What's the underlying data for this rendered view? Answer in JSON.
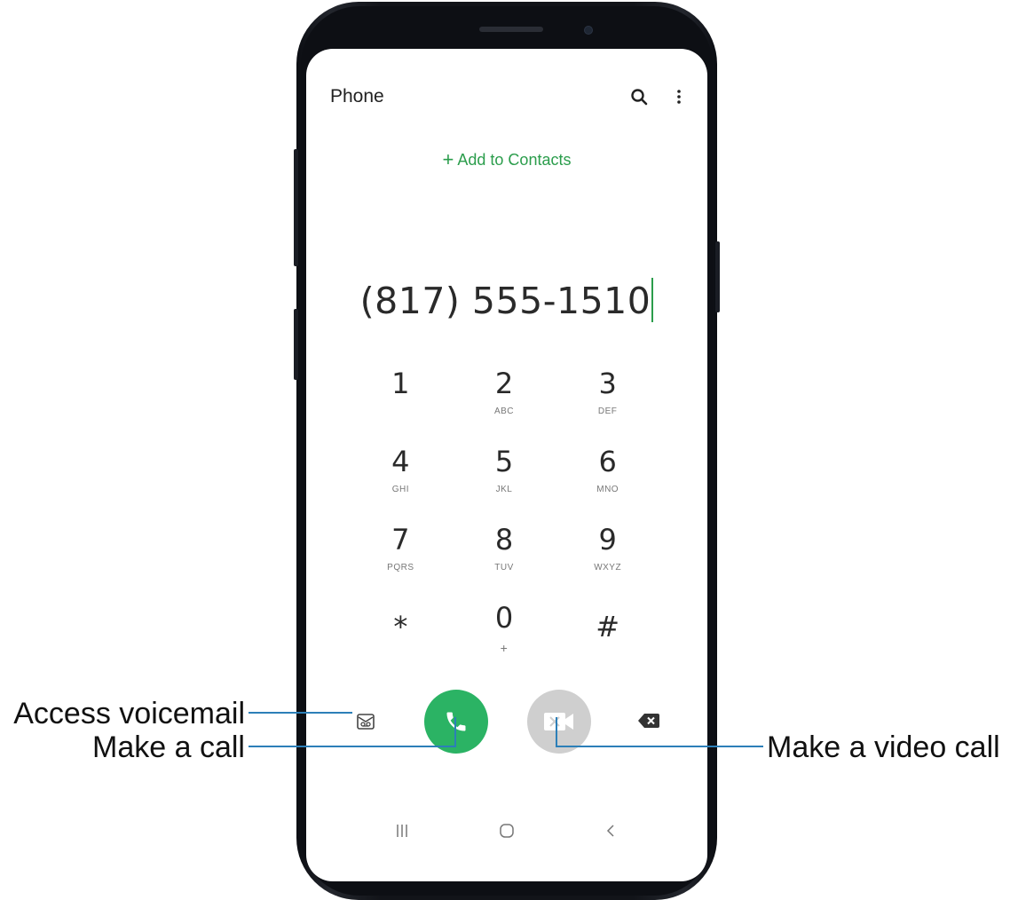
{
  "app": {
    "title": "Phone"
  },
  "header": {
    "search_icon": "search-icon",
    "more_icon": "more-options-icon"
  },
  "add_contacts": {
    "plus": "+",
    "label": "Add to Contacts",
    "color": "#2b9d4c"
  },
  "dialed_number": "(817) 555-1510",
  "keypad": [
    {
      "digit": "1",
      "letters": ""
    },
    {
      "digit": "2",
      "letters": "ABC"
    },
    {
      "digit": "3",
      "letters": "DEF"
    },
    {
      "digit": "4",
      "letters": "GHI"
    },
    {
      "digit": "5",
      "letters": "JKL"
    },
    {
      "digit": "6",
      "letters": "MNO"
    },
    {
      "digit": "7",
      "letters": "PQRS"
    },
    {
      "digit": "8",
      "letters": "TUV"
    },
    {
      "digit": "9",
      "letters": "WXYZ"
    },
    {
      "digit": "*",
      "letters": ""
    },
    {
      "digit": "0",
      "letters": "+"
    },
    {
      "digit": "#",
      "letters": ""
    }
  ],
  "actions": {
    "voicemail_icon": "voicemail-icon",
    "call_icon": "phone-icon",
    "video_call_icon": "video-call-icon",
    "backspace_icon": "backspace-icon",
    "call_color": "#2bb364",
    "video_call_color": "#cfcfcf"
  },
  "nav_bar": {
    "recents_icon": "recents-icon",
    "home_icon": "home-icon",
    "back_icon": "back-icon"
  },
  "callouts": {
    "voicemail": "Access voicemail",
    "call": "Make a call",
    "video_call": "Make a video call",
    "line_color": "#2c7fb8"
  }
}
